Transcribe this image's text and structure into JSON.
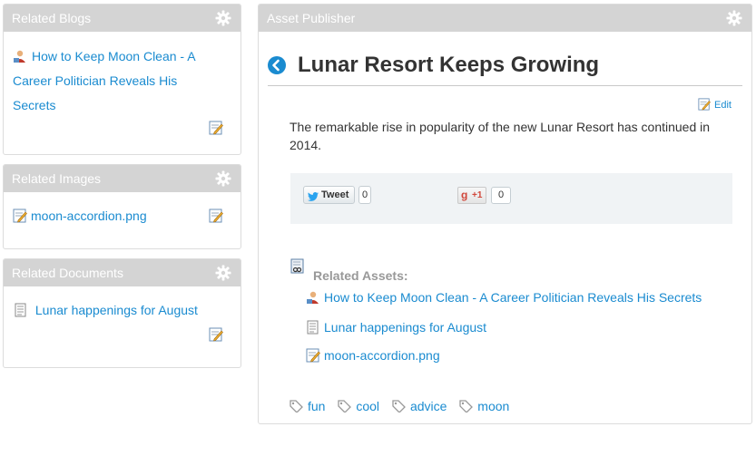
{
  "related_blogs": {
    "title": "Related Blogs",
    "entry": "How to Keep Moon Clean  - A Career Politician Reveals His Secrets",
    "icon": "blog-icon"
  },
  "related_images": {
    "title": "Related Images",
    "entry": "moon-accordion.png",
    "icon": "image-edit-icon"
  },
  "related_documents": {
    "title": "Related Documents",
    "entry": "Lunar happenings for August",
    "icon": "document-icon"
  },
  "publisher": {
    "title": "Asset Publisher",
    "article_title": "Lunar Resort Keeps Growing",
    "edit_label": "Edit",
    "summary": "The remarkable rise in popularity of the new Lunar Resort has continued in 2014.",
    "social": {
      "tweet_label": "Tweet",
      "tweet_count": "0",
      "gplus_label": "+1",
      "gplus_count": "0"
    },
    "related_assets_label": "Related Assets:",
    "related_assets": [
      "How to Keep Moon Clean - A Career Politician Reveals His Secrets",
      "Lunar happenings for August",
      "moon-accordion.png"
    ],
    "tags": [
      "fun",
      "cool",
      "advice",
      "moon"
    ]
  },
  "colors": {
    "link": "#1a8bd0",
    "header_bg": "#d4d4d4",
    "social_bg": "#f0f3f5"
  }
}
